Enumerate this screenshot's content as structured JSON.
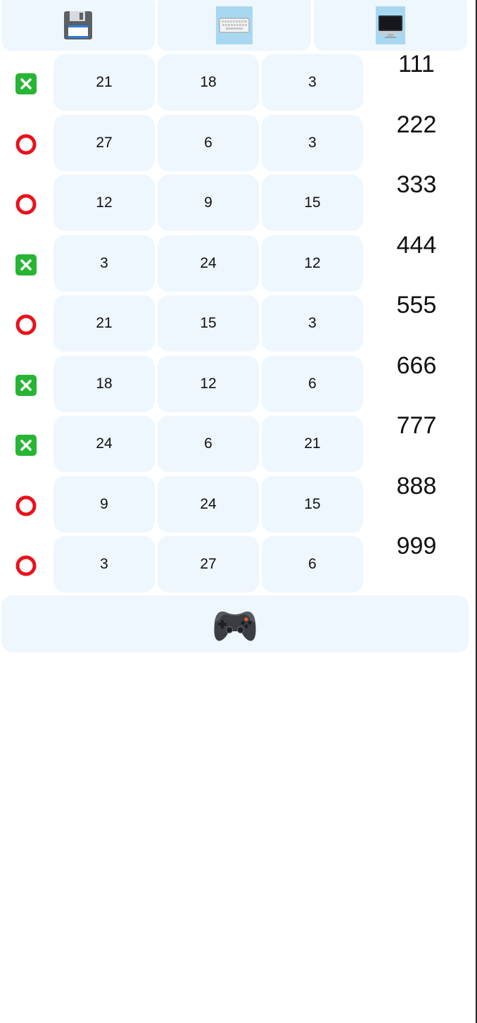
{
  "toolbar": {
    "items": [
      {
        "icon": "floppy-disk-icon"
      },
      {
        "icon": "keyboard-icon"
      },
      {
        "icon": "desktop-computer-icon"
      }
    ]
  },
  "rows": [
    {
      "status": "cross-mark",
      "values": [
        "21",
        "18",
        "3"
      ],
      "side": "111"
    },
    {
      "status": "circle",
      "values": [
        "27",
        "6",
        "3"
      ],
      "side": "222"
    },
    {
      "status": "circle",
      "values": [
        "12",
        "9",
        "15"
      ],
      "side": "333"
    },
    {
      "status": "cross-mark",
      "values": [
        "3",
        "24",
        "12"
      ],
      "side": "444"
    },
    {
      "status": "circle",
      "values": [
        "21",
        "15",
        "3"
      ],
      "side": "555"
    },
    {
      "status": "cross-mark",
      "values": [
        "18",
        "12",
        "6"
      ],
      "side": "666"
    },
    {
      "status": "cross-mark",
      "values": [
        "24",
        "6",
        "21"
      ],
      "side": "777"
    },
    {
      "status": "circle",
      "values": [
        "9",
        "24",
        "15"
      ],
      "side": "888"
    },
    {
      "status": "circle",
      "values": [
        "3",
        "27",
        "6"
      ],
      "side": "999"
    }
  ],
  "bottom": {
    "icon": "game-controller-icon"
  },
  "colors": {
    "panel_bg": "#eef6fe",
    "highlight_bg": "#a8d8f0",
    "cross_green": "#27b534",
    "circle_red": "#e8121b"
  }
}
